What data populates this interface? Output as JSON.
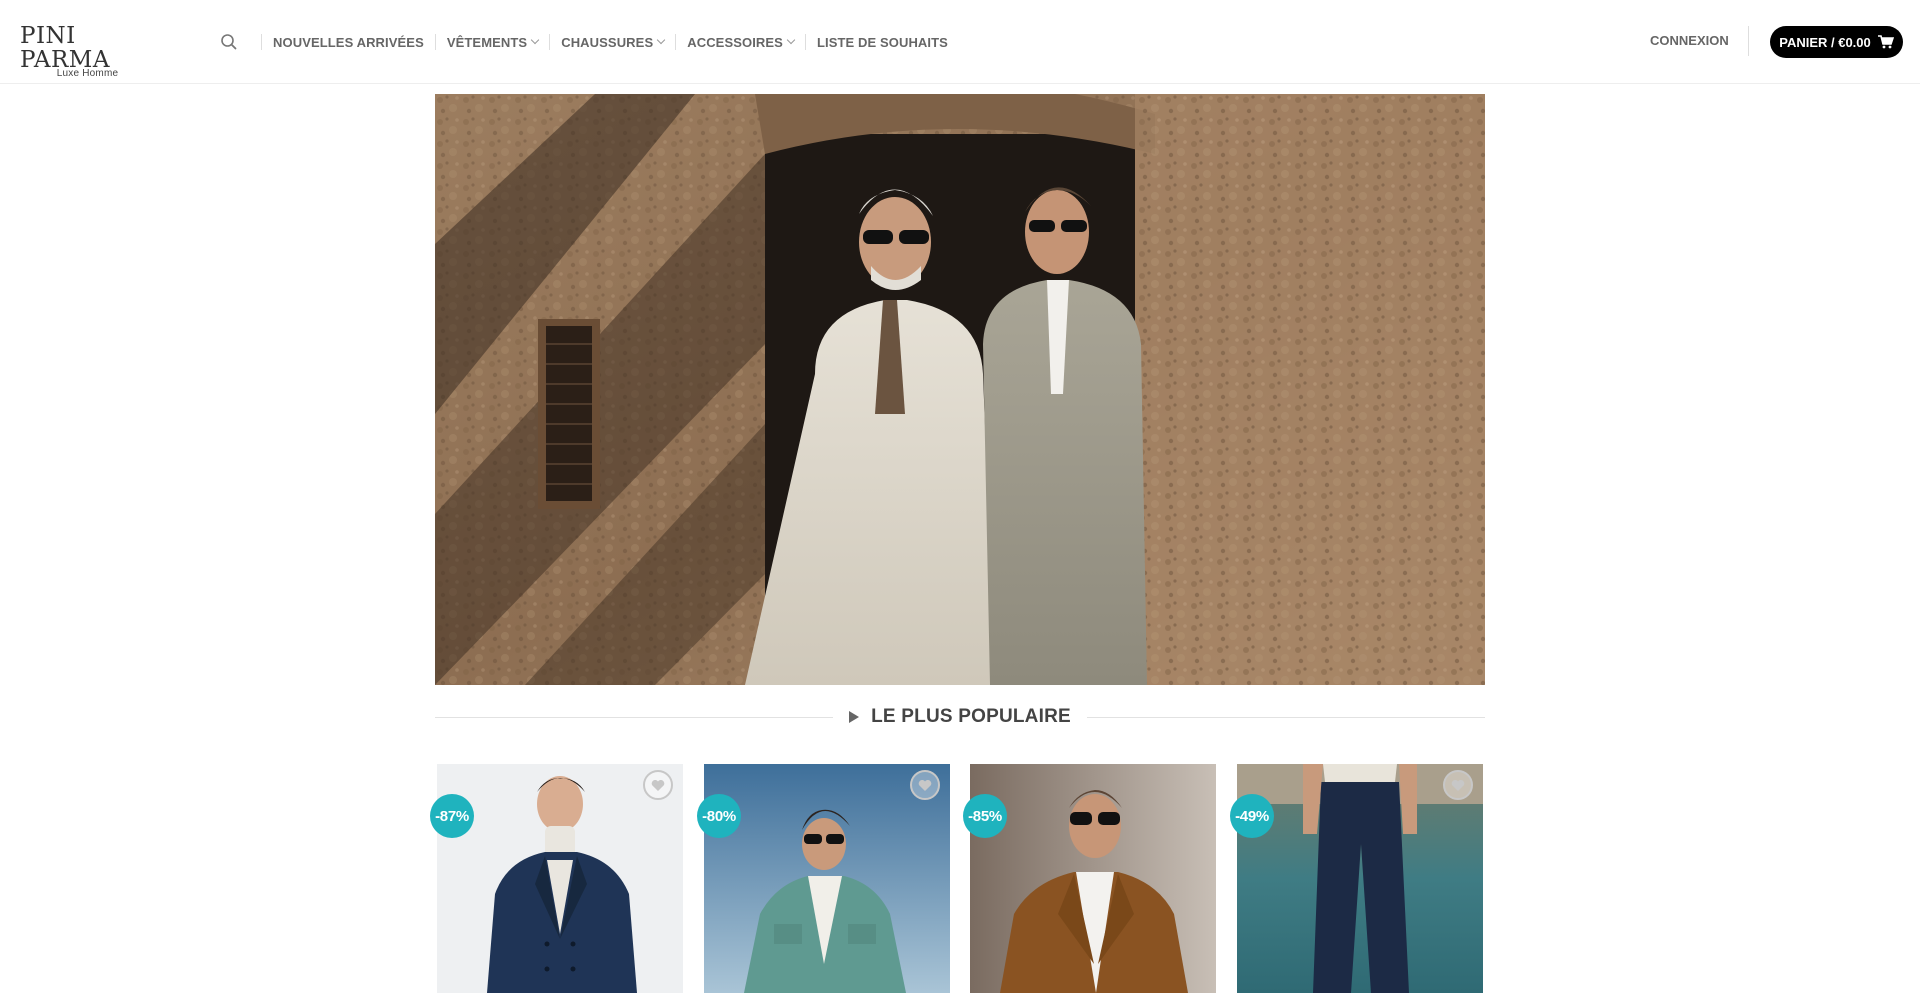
{
  "brand": {
    "name": "PINI PARMA",
    "tagline": "Luxe Homme"
  },
  "nav": {
    "search_icon": "search-icon",
    "items": [
      {
        "label": "NOUVELLES ARRIVÉES",
        "has_dropdown": false
      },
      {
        "label": "VÊTEMENTS",
        "has_dropdown": true
      },
      {
        "label": "CHAUSSURES",
        "has_dropdown": true
      },
      {
        "label": "ACCESSOIRES",
        "has_dropdown": true
      },
      {
        "label": "LISTE DE SOUHAITS",
        "has_dropdown": false
      }
    ]
  },
  "account": {
    "login_label": "CONNEXION"
  },
  "cart": {
    "label": "PANIER / €0.00",
    "icon": "cart-icon",
    "bg_color": "#000000"
  },
  "hero": {
    "image": "two men in light suits and sunglasses in front of a stone wall"
  },
  "section": {
    "title": "LE PLUS POPULAIRE"
  },
  "colors": {
    "badge": "#1fb3be",
    "text": "#666666"
  },
  "products": [
    {
      "discount": "-87%",
      "image": "navy double-breasted blazer with white turtleneck"
    },
    {
      "discount": "-80%",
      "image": "teal overshirt against blue sky"
    },
    {
      "discount": "-85%",
      "image": "camel brown jacket with white shirt"
    },
    {
      "discount": "-49%",
      "image": "navy trousers by a pool"
    }
  ]
}
